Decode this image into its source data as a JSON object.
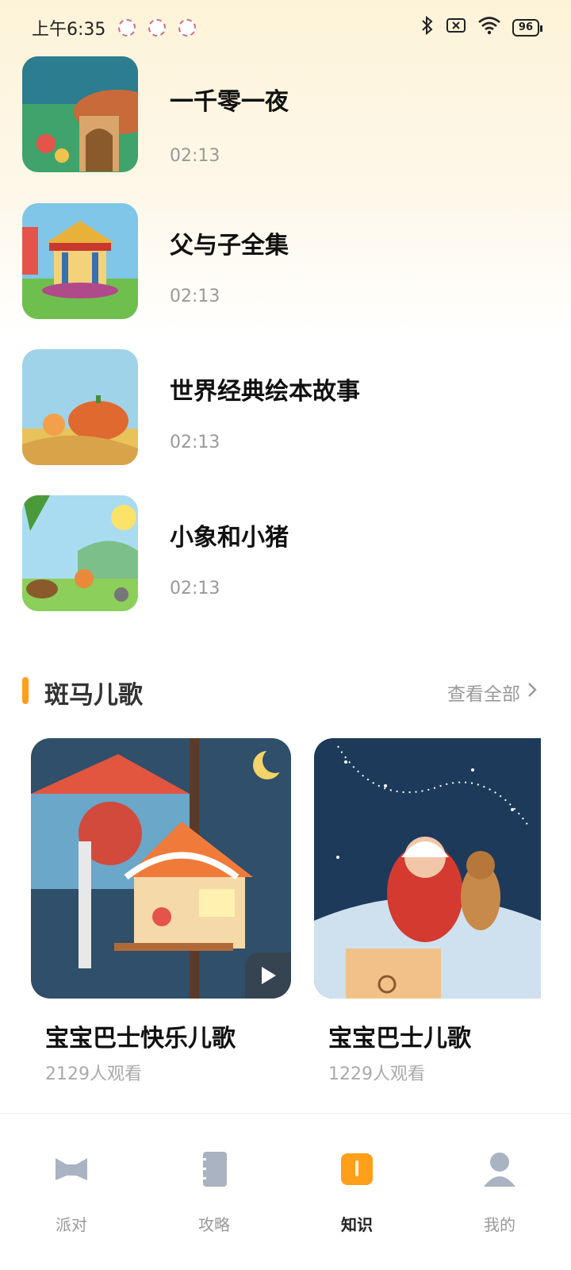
{
  "status_bar": {
    "time": "上午6:35",
    "battery": "96"
  },
  "stories": [
    {
      "title": "一千零一夜",
      "duration": "02:13"
    },
    {
      "title": "父与子全集",
      "duration": "02:13"
    },
    {
      "title": "世界经典绘本故事",
      "duration": "02:13"
    },
    {
      "title": "小象和小猪",
      "duration": "02:13"
    }
  ],
  "section": {
    "title": "斑马儿歌",
    "see_all": "查看全部"
  },
  "cards": [
    {
      "title": "宝宝巴士快乐儿歌",
      "views": "2129人观看"
    },
    {
      "title": "宝宝巴士儿歌",
      "views": "1229人观看"
    }
  ],
  "tabs": [
    {
      "label": "派对"
    },
    {
      "label": "攻略"
    },
    {
      "label": "知识"
    },
    {
      "label": "我的"
    }
  ],
  "colors": {
    "accent": "#ff9f1a",
    "muted": "#999999"
  }
}
